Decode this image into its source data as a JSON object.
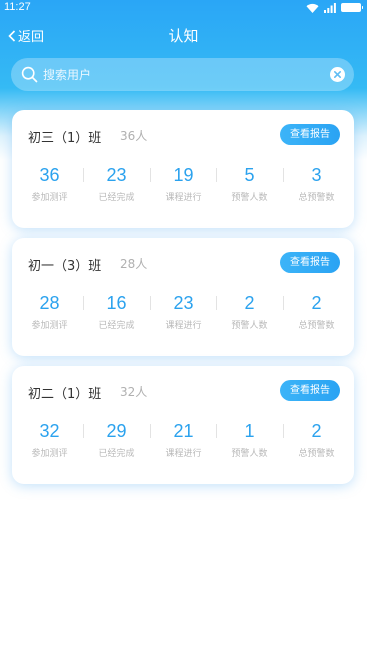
{
  "status_bar": {
    "time": "11:27"
  },
  "nav": {
    "back_label": "返回",
    "title": "认知"
  },
  "search": {
    "placeholder": "搜索用户"
  },
  "report_button_label": "查看报告",
  "stat_labels": [
    "参加测评",
    "已经完成",
    "课程进行",
    "预警人数",
    "总预警数"
  ],
  "classes": [
    {
      "name": "初三（1）班",
      "count": "36人",
      "stats": [
        "36",
        "23",
        "19",
        "5",
        "3"
      ]
    },
    {
      "name": "初一（3）班",
      "count": "28人",
      "stats": [
        "28",
        "16",
        "23",
        "2",
        "2"
      ]
    },
    {
      "name": "初二（1）班",
      "count": "32人",
      "stats": [
        "32",
        "29",
        "21",
        "1",
        "2"
      ]
    }
  ],
  "colors": {
    "accent": "#2ba2ee",
    "header": "#2aa6f6"
  }
}
